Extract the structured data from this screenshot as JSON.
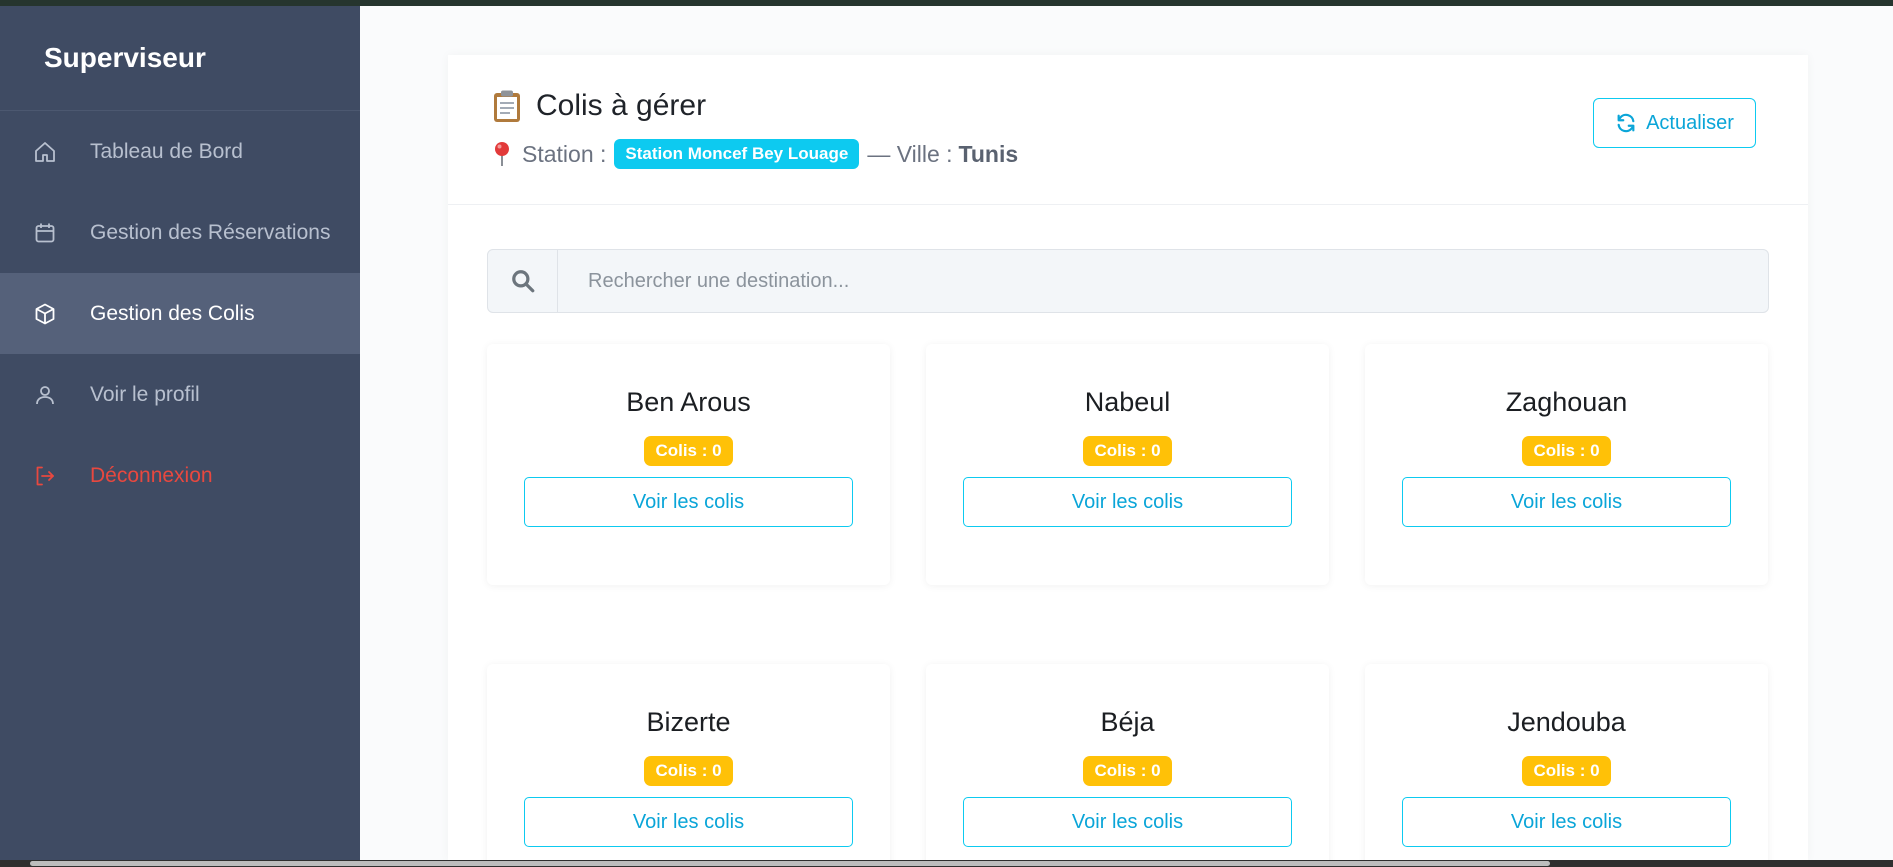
{
  "sidebar": {
    "brand": "Superviseur",
    "items": [
      {
        "label": "Tableau de Bord",
        "icon": "home-icon"
      },
      {
        "label": "Gestion des Réservations",
        "icon": "calendar-icon"
      },
      {
        "label": "Gestion des Colis",
        "icon": "box-icon",
        "active": true
      },
      {
        "label": "Voir le profil",
        "icon": "user-icon"
      },
      {
        "label": "Déconnexion",
        "icon": "logout-icon"
      }
    ]
  },
  "header": {
    "title": "Colis à gérer",
    "station_label": "Station :",
    "station_name": "Station Moncef Bey Louage",
    "city_label": "— Ville :",
    "city_name": "Tunis",
    "refresh_label": "Actualiser"
  },
  "search": {
    "placeholder": "Rechercher une destination..."
  },
  "destinations": [
    {
      "name": "Ben Arous",
      "count_label": "Colis : 0",
      "button_label": "Voir les colis"
    },
    {
      "name": "Nabeul",
      "count_label": "Colis : 0",
      "button_label": "Voir les colis"
    },
    {
      "name": "Zaghouan",
      "count_label": "Colis : 0",
      "button_label": "Voir les colis"
    },
    {
      "name": "Bizerte",
      "count_label": "Colis : 0",
      "button_label": "Voir les colis"
    },
    {
      "name": "Béja",
      "count_label": "Colis : 0",
      "button_label": "Voir les colis"
    },
    {
      "name": "Jendouba",
      "count_label": "Colis : 0",
      "button_label": "Voir les colis"
    }
  ],
  "colors": {
    "sidebar_bg": "#3f4b63",
    "active_bg": "#55617a",
    "accent": "#0dcaf0",
    "badge_warning": "#ffc107",
    "logout": "#e8483f"
  }
}
